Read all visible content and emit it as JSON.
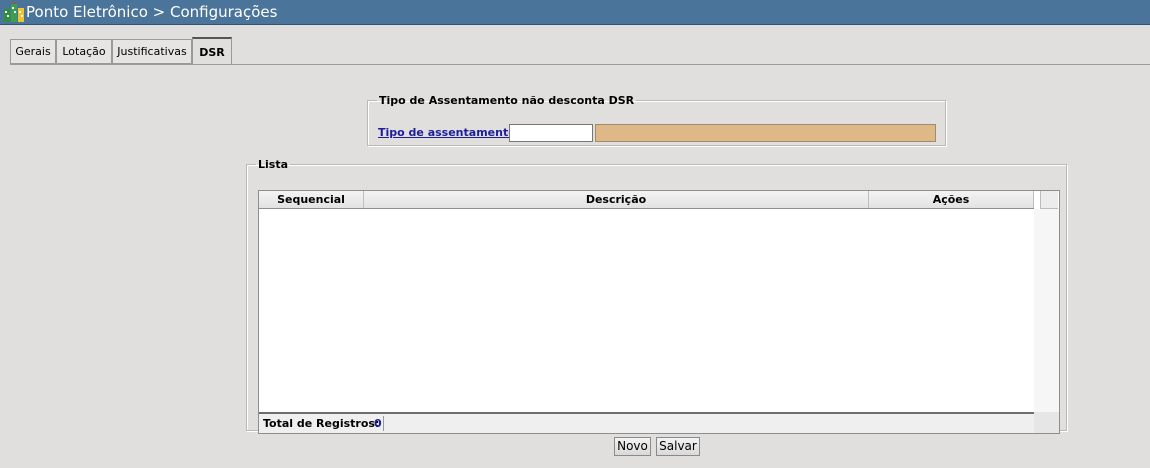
{
  "window": {
    "title": "Ponto Eletrônico > Configurações"
  },
  "tabs": [
    {
      "label": "Gerais",
      "active": false
    },
    {
      "label": "Lotação",
      "active": false
    },
    {
      "label": "Justificativas",
      "active": false
    },
    {
      "label": "DSR",
      "active": true
    }
  ],
  "tipo_section": {
    "legend": "Tipo de Assentamento não desconta DSR",
    "field_label": "Tipo de assentamento:",
    "code_value": "",
    "description_value": ""
  },
  "lista": {
    "legend": "Lista",
    "columns": [
      "Sequencial",
      "Descrição",
      "Ações"
    ],
    "rows": [],
    "total_label": "Total de Registros:",
    "total_value": "0"
  },
  "buttons": {
    "novo": "Novo",
    "salvar": "Salvar"
  },
  "colors": {
    "titlebar": "#4a7499",
    "link": "#1d1d9b",
    "readonly_field": "#deb887"
  },
  "icons": {
    "app_logo": "building-icon"
  }
}
